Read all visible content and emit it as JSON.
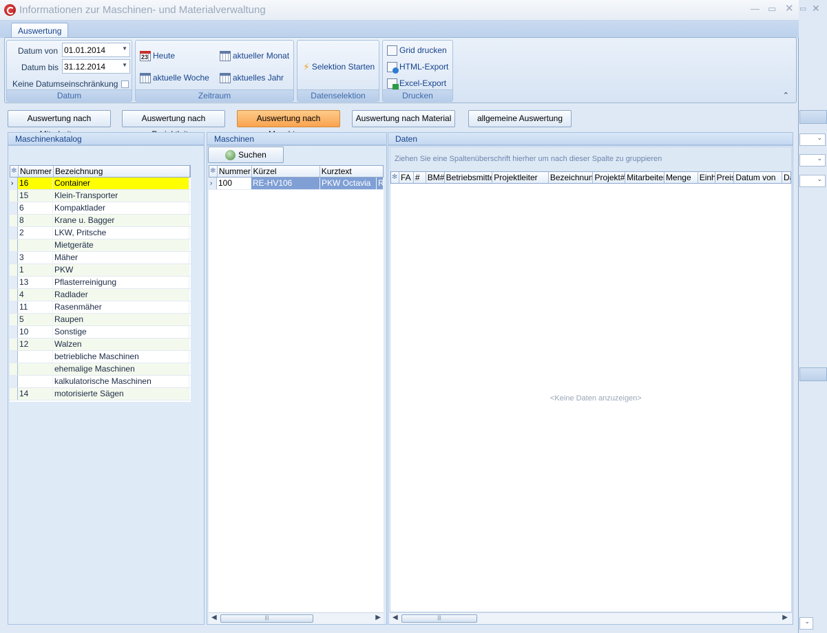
{
  "window": {
    "title": "Informationen zur Maschinen- und Materialverwaltung"
  },
  "tabs": [
    {
      "label": "Auswertung"
    }
  ],
  "ribbon": {
    "datum": {
      "label": "Datum",
      "von_label": "Datum von",
      "von_value": "01.01.2014",
      "bis_label": "Datum bis",
      "bis_value": "31.12.2014",
      "keine_label": "Keine Datumseinschränkung"
    },
    "zeitraum": {
      "label": "Zeitraum",
      "heute": "Heute",
      "heute_day": "23",
      "woche": "aktuelle Woche",
      "monat": "aktueller Monat",
      "jahr": "aktuelles Jahr"
    },
    "datenselektion": {
      "label": "Datenselektion",
      "start": "Selektion Starten"
    },
    "drucken": {
      "label": "Drucken",
      "grid": "Grid drucken",
      "html": "HTML-Export",
      "excel": "Excel-Export"
    }
  },
  "eval_buttons": [
    {
      "label": "Auswertung nach Mitarbeiter",
      "active": false
    },
    {
      "label": "Auswertung nach Projektleiter",
      "active": false
    },
    {
      "label": "Auswertung nach Maschinen",
      "active": true
    },
    {
      "label": "Auswertung nach Material",
      "active": false
    },
    {
      "label": "allgemeine Auswertung",
      "active": false
    }
  ],
  "catalog": {
    "title": "Maschinenkatalog",
    "columns": [
      "Nummer",
      "Bezeichnung"
    ],
    "rows": [
      {
        "nummer": "16",
        "bezeichnung": "Container"
      },
      {
        "nummer": "15",
        "bezeichnung": "Klein-Transporter"
      },
      {
        "nummer": "6",
        "bezeichnung": "Kompaktlader"
      },
      {
        "nummer": "8",
        "bezeichnung": "Krane u. Bagger"
      },
      {
        "nummer": "2",
        "bezeichnung": "LKW, Pritsche"
      },
      {
        "nummer": "",
        "bezeichnung": "Mietgeräte"
      },
      {
        "nummer": "3",
        "bezeichnung": "Mäher"
      },
      {
        "nummer": "1",
        "bezeichnung": "PKW"
      },
      {
        "nummer": "13",
        "bezeichnung": "Pflasterreinigung"
      },
      {
        "nummer": "4",
        "bezeichnung": "Radlader"
      },
      {
        "nummer": "11",
        "bezeichnung": "Rasenmäher"
      },
      {
        "nummer": "5",
        "bezeichnung": "Raupen"
      },
      {
        "nummer": "10",
        "bezeichnung": "Sonstige"
      },
      {
        "nummer": "12",
        "bezeichnung": "Walzen"
      },
      {
        "nummer": "",
        "bezeichnung": "betriebliche Maschinen"
      },
      {
        "nummer": "",
        "bezeichnung": "ehemalige Maschinen"
      },
      {
        "nummer": "",
        "bezeichnung": "kalkulatorische Maschinen"
      },
      {
        "nummer": "14",
        "bezeichnung": "motorisierte Sägen"
      }
    ]
  },
  "machines": {
    "title": "Maschinen",
    "search_label": "Suchen",
    "columns": [
      "Nummer",
      "Kürzel",
      "Kurztext"
    ],
    "rows": [
      {
        "nummer": "100",
        "kuerzel": "RE-HV106",
        "kurztext": "PKW Octavia",
        "extra": "R"
      }
    ]
  },
  "data_panel": {
    "title": "Daten",
    "group_hint": "Ziehen Sie eine Spaltenüberschrift hierher um nach dieser Spalte zu gruppieren",
    "columns": [
      "FA",
      "#",
      "BM#",
      "Betriebsmittel",
      "Projektleiter",
      "Bezeichnung",
      "Projekt#",
      "Mitarbeiter",
      "Menge",
      "Einh",
      "Preis",
      "Datum von",
      "Da"
    ],
    "no_data": "<Keine Daten anzuzeigen>"
  },
  "colors": {
    "selected_row": "#ffff00",
    "active_button": "#f9a34f",
    "selected_machine": "#7f9fd5"
  }
}
